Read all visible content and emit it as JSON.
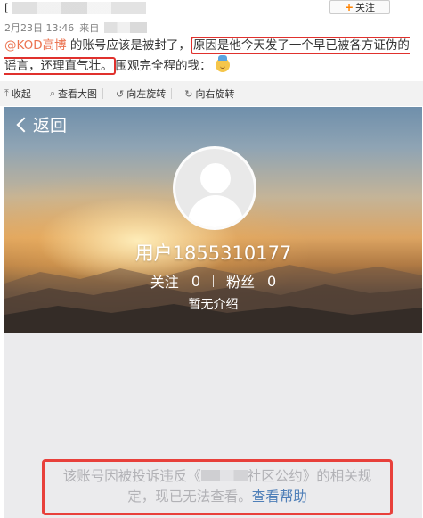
{
  "header": {
    "bracket": "[",
    "follow_plus": "+",
    "follow_label": "关注"
  },
  "meta": {
    "date_time": "2月23日 13:46",
    "from_label": "来自"
  },
  "post": {
    "mention": "@KOD高博",
    "text_before": " 的账号应该是被封了，",
    "highlight_1": "原因是他今天发了一个早已被各方证伪的谣言，还理直气壮。",
    "text_after": "围观完全程的我："
  },
  "toolbar": {
    "collapse": "收起",
    "view_large": "查看大图",
    "rotate_left": "向左旋转",
    "rotate_right": "向右旋转"
  },
  "profile": {
    "back_label": "返回",
    "username": "用户1855310177",
    "following_label": "关注",
    "following_count": "0",
    "followers_label": "粉丝",
    "followers_count": "0",
    "intro": "暂无介绍"
  },
  "notice": {
    "part1": "该账号因被投诉违反《",
    "part2": "社区公约》的相关规定，现已无法查看。",
    "help_link": "查看帮助"
  }
}
